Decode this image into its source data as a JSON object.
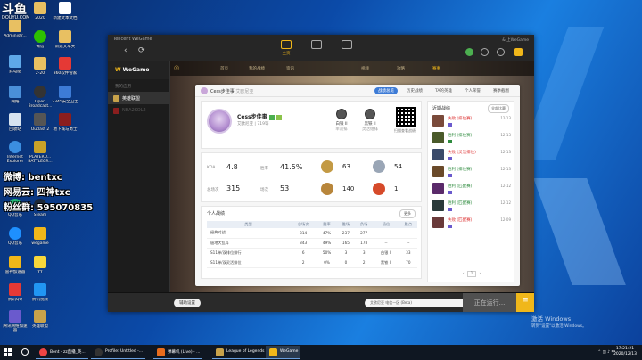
{
  "watermark": {
    "brand": "斗鱼",
    "sub": "DOUYU.COM"
  },
  "overlay": {
    "weibo": "微博: bentxc",
    "wangyi": "网易云: 四神txc",
    "fans": "粉丝群: 595070835"
  },
  "desktop_icons": [
    {
      "label": "回收站"
    },
    {
      "label": "2020"
    },
    {
      "label": "新建文本文档"
    },
    {
      "label": "Administr..."
    },
    {
      "label": "微信"
    },
    {
      "label": "新建文本夹"
    },
    {
      "label": "此电脑"
    },
    {
      "label": "2-20"
    },
    {
      "label": "360软件管家"
    },
    {
      "label": "网络"
    },
    {
      "label": "Open Broadcast..."
    },
    {
      "label": "2345安全卫士"
    },
    {
      "label": "回收站"
    },
    {
      "label": "Outlast 2"
    },
    {
      "label": "地下城与勇士"
    },
    {
      "label": "Internet Explorer"
    },
    {
      "label": "PLAYERU... BATTLEGR..."
    },
    {
      "label": "QQ音乐"
    },
    {
      "label": "Steam"
    },
    {
      "label": "QQ音乐"
    },
    {
      "label": "wegame"
    },
    {
      "label": "雷神加速器"
    },
    {
      "label": "YY"
    },
    {
      "label": "腾讯QQ"
    },
    {
      "label": "腾讯视频"
    },
    {
      "label": "腾讯网络加速器"
    },
    {
      "label": "英雄联盟"
    }
  ],
  "app": {
    "brand": "Tencent WeGame",
    "top_tabs": [
      {
        "label": "主页"
      },
      {
        "label": ""
      },
      {
        "label": ""
      }
    ],
    "top_right": "& 上WeGame",
    "logo": "WeGame",
    "sidebar_section": "我的应用",
    "sidebar_items": [
      {
        "label": "英雄联盟"
      },
      {
        "label": "NBA2KOL2"
      }
    ],
    "game_nav": [
      "首页",
      "我的战绩",
      "资讯",
      "视频",
      "攻略",
      "赛事"
    ],
    "panel": {
      "head_name": "Cess步佳事",
      "head_sub": "艾欧尼亚",
      "tabs": [
        "战绩总览",
        "历史战绩",
        "TA的英雄",
        "个人荣誉",
        "赛季截图"
      ],
      "profile": {
        "name": "Cess步佳事",
        "sub": "艾欧尼亚 | 719等",
        "rank1_label": "白银 II",
        "rank1_sub": "单双排",
        "rank2_label": "黑铁 II",
        "rank2_sub": "灵活组排",
        "qr_label": "扫描查看战绩"
      },
      "stats": {
        "kda_label": "KDA",
        "kda": "4.8",
        "winrate_label": "胜率",
        "winrate": "41.5%",
        "total_label": "总场次",
        "total": "315",
        "wins_label": "场次",
        "wins": "53",
        "medals": [
          "63",
          "54",
          "140",
          "1"
        ]
      },
      "records": {
        "title": "个人战绩",
        "more": "更多",
        "headers": [
          "类型",
          "总场次",
          "胜率",
          "胜场",
          "负场",
          "段位",
          "胜点"
        ],
        "rows": [
          [
            "经典对战",
            "314",
            "47%",
            "237",
            "277",
            "--",
            "--"
          ],
          [
            "极地大乱斗",
            "343",
            "49%",
            "165",
            "178",
            "--",
            "--"
          ],
          [
            "S11单/双排位排行",
            "6",
            "50%",
            "3",
            "3",
            "白银 II",
            "33"
          ],
          [
            "S11单/双灵活排位",
            "2",
            "0%",
            "0",
            "2",
            "黑铁 II",
            "70"
          ]
        ]
      },
      "recent": {
        "title": "近期战绩",
        "filter": "全部比赛",
        "items": [
          {
            "result": "失败 (排位赛)",
            "date": "12-13",
            "win": false
          },
          {
            "result": "胜利 (排位赛)",
            "date": "12-13",
            "win": true
          },
          {
            "result": "失败 (灵活排位)",
            "date": "12-13",
            "win": false
          },
          {
            "result": "胜利 (排位赛)",
            "date": "12-13",
            "win": true
          },
          {
            "result": "胜利 (匹配赛)",
            "date": "12-12",
            "win": true
          },
          {
            "result": "胜利 (匹配赛)",
            "date": "12-12",
            "win": true
          },
          {
            "result": "失败 (匹配赛)",
            "date": "12-09",
            "win": false
          }
        ],
        "page": "1"
      }
    },
    "bottom": {
      "assist": "辅助设置",
      "status": "艾欧尼亚 电信一区 (Beta)",
      "run": "正在运行..."
    }
  },
  "activation": {
    "title": "激活 Windows",
    "sub": "转到\"设置\"以激活 Windows。"
  },
  "taskbar": {
    "apps": [
      {
        "label": "Bent - zz直播_英..."
      },
      {
        "label": "Profile: Untitled -..."
      },
      {
        "label": "弹幕机 (Live) - ..."
      },
      {
        "label": "League of Legends"
      },
      {
        "label": "WeGame"
      }
    ],
    "time": "17:21:21",
    "date": "2020/12/13"
  }
}
